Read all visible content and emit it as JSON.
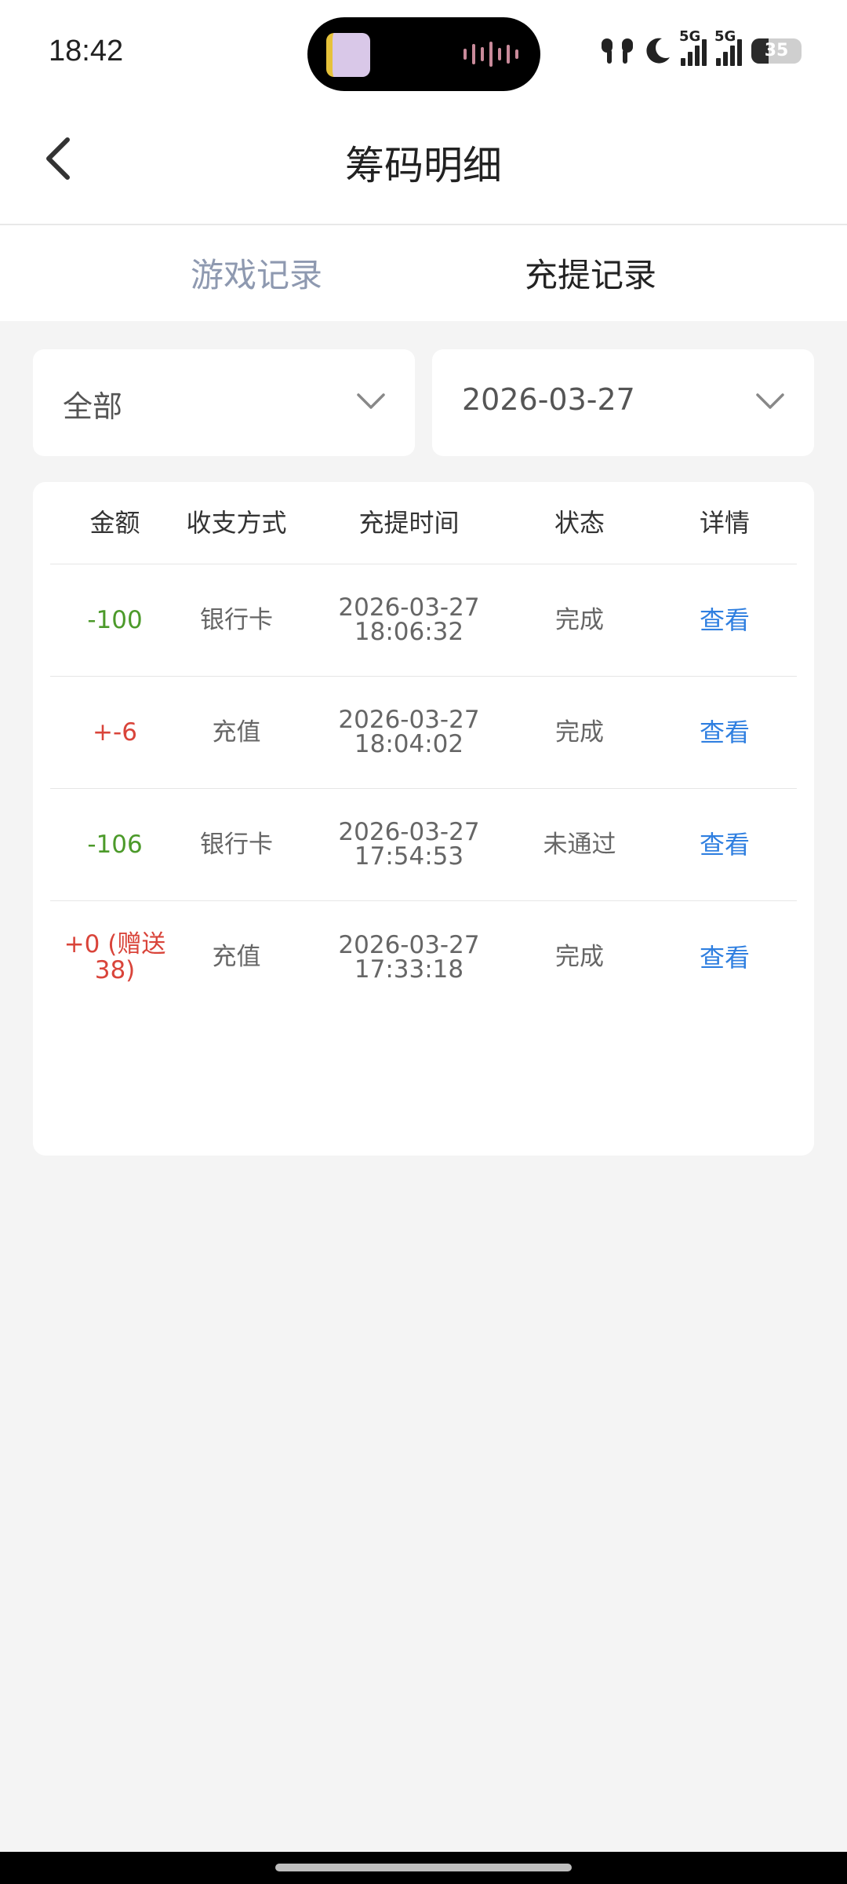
{
  "status_bar": {
    "time": "18:42",
    "network_labels": [
      "5G",
      "5G"
    ],
    "battery_level": "35",
    "icons": [
      "earbuds-icon",
      "moon-icon",
      "signal-icon",
      "signal-icon",
      "battery-icon"
    ]
  },
  "header": {
    "title": "筹码明细",
    "back_icon": "chevron-left-icon"
  },
  "tabs": [
    {
      "label": "游戏记录",
      "active": false
    },
    {
      "label": "充提记录",
      "active": true
    }
  ],
  "filters": {
    "type": {
      "value": "全部",
      "icon": "chevron-down-icon"
    },
    "date": {
      "value": "2026-03-27",
      "icon": "chevron-down-icon"
    }
  },
  "table": {
    "headers": [
      "金额",
      "收支方式",
      "充提时间",
      "状态",
      "详情"
    ],
    "rows": [
      {
        "amount": "-100",
        "amount_color": "#4c9a2a",
        "method": "银行卡",
        "date": "2026-03-27",
        "time": "18:06:32",
        "status": "完成",
        "detail": "查看"
      },
      {
        "amount": "+-6",
        "amount_color": "#d9443a",
        "method": "充值",
        "date": "2026-03-27",
        "time": "18:04:02",
        "status": "完成",
        "detail": "查看"
      },
      {
        "amount": "-106",
        "amount_color": "#4c9a2a",
        "method": "银行卡",
        "date": "2026-03-27",
        "time": "17:54:53",
        "status": "未通过",
        "detail": "查看"
      },
      {
        "amount": "+0 (赠送38)",
        "amount_color": "#d9443a",
        "method": "充值",
        "date": "2026-03-27",
        "time": "17:33:18",
        "status": "完成",
        "detail": "查看"
      }
    ]
  },
  "colors": {
    "link": "#2f7fe0",
    "negative_amount": "#4c9a2a",
    "positive_amount": "#d9443a",
    "inactive_tab": "#8e99b0"
  }
}
